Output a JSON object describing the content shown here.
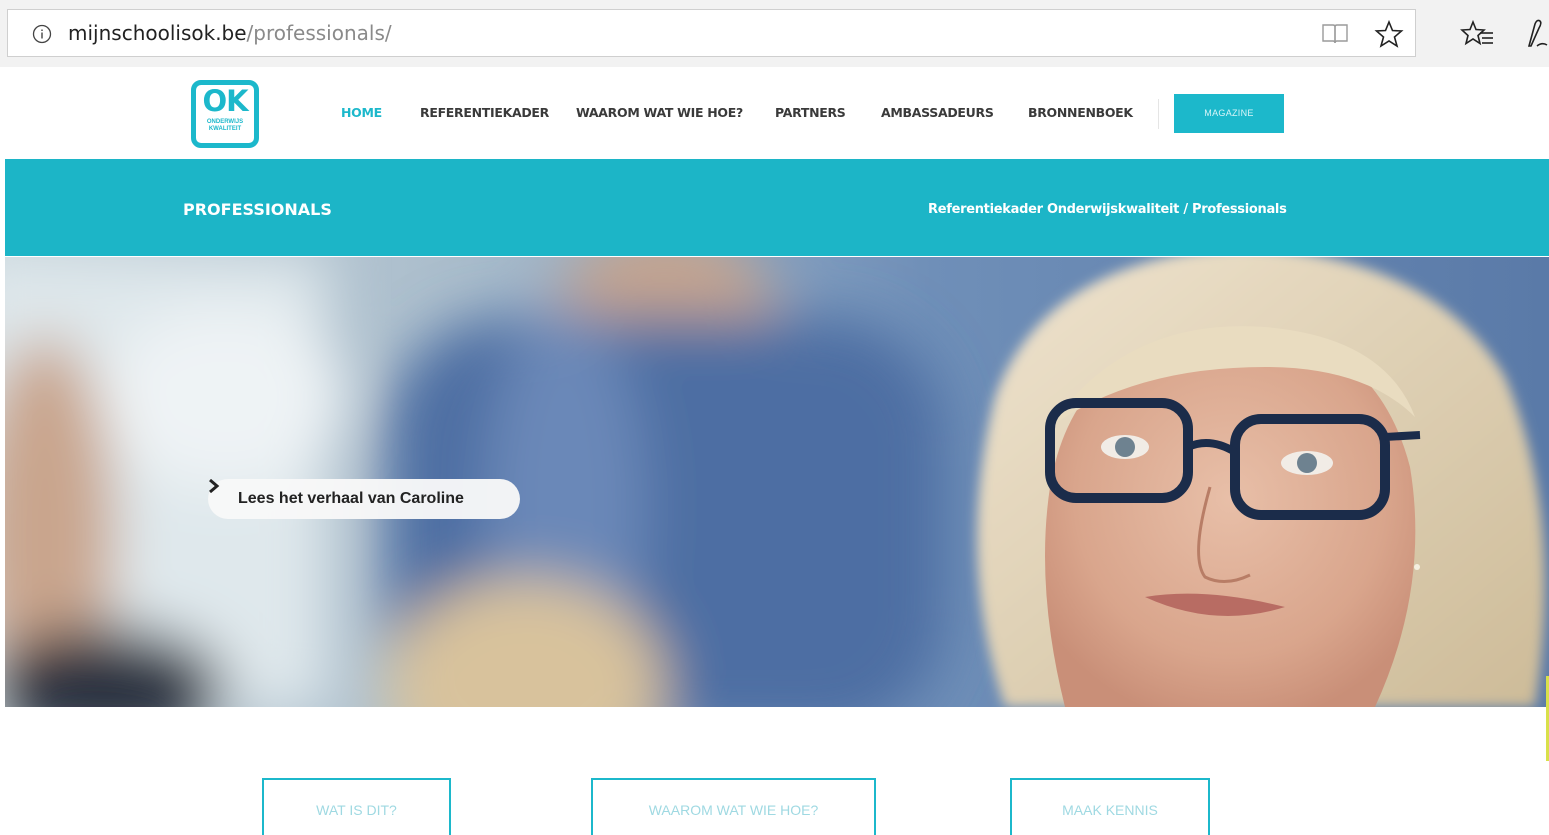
{
  "browser": {
    "url_domain": "mijnschoolisok.be",
    "url_path": "/professionals/",
    "icons": [
      "info-icon",
      "reading-view-icon",
      "star-icon",
      "favorites-icon",
      "pen-icon"
    ]
  },
  "header": {
    "logo": {
      "text": "OK",
      "sub_line1": "ONDERWIJS",
      "sub_line2": "KWALITEIT"
    },
    "nav": [
      {
        "label": "HOME",
        "active": true
      },
      {
        "label": "REFERENTIEKADER",
        "active": false
      },
      {
        "label": "WAAROM WAT WIE HOE?",
        "active": false
      },
      {
        "label": "PARTNERS",
        "active": false
      },
      {
        "label": "AMBASSADEURS",
        "active": false
      },
      {
        "label": "BRONNENBOEK",
        "active": false
      }
    ],
    "magazine_label": "MAGAZINE"
  },
  "title_band": {
    "title": "PROFESSIONALS",
    "breadcrumb": "Referentiekader Onderwijskwaliteit / Professionals"
  },
  "hero": {
    "cta_label": "Lees het verhaal van Caroline"
  },
  "buttons": {
    "wat_is_dit": "WAT IS DIT?",
    "waarom": "WAAROM WAT WIE HOE?",
    "maak_kennis": "MAAK KENNIS"
  },
  "colors": {
    "accent": "#1cb8cb",
    "band": "#1cb5c7"
  }
}
